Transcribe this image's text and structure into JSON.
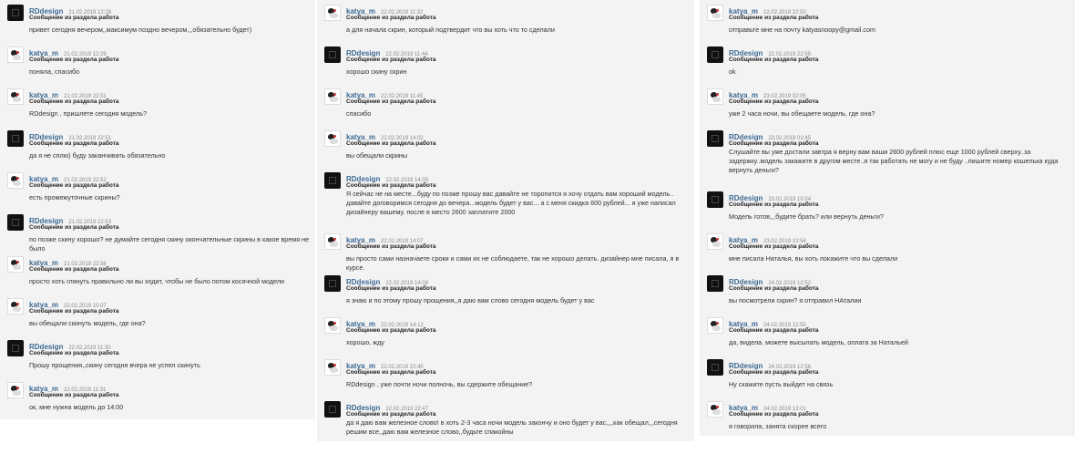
{
  "columns": [
    {
      "messages": [
        {
          "author": "RDdesign",
          "date": "21.02.2019 12:28",
          "subject": "Сообщение из раздела работа",
          "text": "привет сегодня вечером,,максимум поздно вечером,,,обязательно будет)"
        },
        {
          "author": "katya_m",
          "date": "21.02.2019 12:29",
          "subject": "Сообщение из раздела работа",
          "text": "поняла, спасибо"
        },
        {
          "author": "katya_m",
          "date": "21.02.2019 22:51",
          "subject": "Сообщение из раздела работа",
          "text": "RDdesign , пришлете сегодня модель?"
        },
        {
          "author": "RDdesign",
          "date": "21.02.2019 22:51",
          "subject": "Сообщение из раздела работа",
          "text": "да я не сплю) буду заканчивать обязательно"
        },
        {
          "author": "katya_m",
          "date": "21.02.2019 22:52",
          "subject": "Сообщение из раздела работа",
          "text": "есть промежуточные скрины?"
        },
        {
          "author": "RDdesign",
          "date": "21.02.2019 22:53",
          "subject": "Сообщение из раздела работа",
          "text": "по позже скину хорошо? не думайте сегодня скину окончательные скрины в какое время не было"
        },
        {
          "author": "katya_m",
          "date": "21.02.2019 22:56",
          "subject": "Сообщение из раздела работа",
          "text": "просто хоть глянуть правильно ли вы ходит, чтобы не было потом косячной модели"
        },
        {
          "author": "katya_m",
          "date": "22.02.2019 10:07",
          "subject": "Сообщение из раздела работа",
          "text": "вы обещали скинуть модель, где она?"
        },
        {
          "author": "RDdesign",
          "date": "22.02.2019 11:30",
          "subject": "Сообщение из раздела работа",
          "text": "Прошу прощения,,скину сегодня вчера не успел скинуть"
        },
        {
          "author": "katya_m",
          "date": "22.02.2019 11:31",
          "subject": "Сообщение из раздела работа",
          "text": "ок, мне нужна модель до 14:00"
        }
      ]
    },
    {
      "messages": [
        {
          "author": "katya_m",
          "date": "22.02.2019 11:32",
          "subject": "Сообщение из раздела работа",
          "text": "а для начала скрин, который подтвердит что вы хоть что то сделали"
        },
        {
          "author": "RDdesign",
          "date": "22.02.2019 11:44",
          "subject": "Сообщение из раздела работа",
          "text": "хорошо скину скрин"
        },
        {
          "author": "katya_m",
          "date": "22.02.2019 11:45",
          "subject": "Сообщение из раздела работа",
          "text": "спасибо"
        },
        {
          "author": "katya_m",
          "date": "22.02.2019 14:02",
          "subject": "Сообщение из раздела работа",
          "text": "вы обещали скрины"
        },
        {
          "author": "RDdesign",
          "date": "22.02.2019 14:05",
          "subject": "Сообщение из раздела работа",
          "text": "Я сейчас не на месте...буду по позже прошу вас давайте не торопится я хочу отдать вам хороший модель.. давайте договоримся сегодня до вечера...модель будет у вас... а с меня скидка 600 рублей... я уже написал дизайнеру вашему. после в место 2600 заплатите 2000",
          "tall": true
        },
        {
          "author": "katya_m",
          "date": "22.02.2019 14:07",
          "subject": "Сообщение из раздела работа",
          "text": "вы просто сами назначаете сроки и сами их не соблюдаете, так не хорошо делать. дизайнер мне писала, я в курсе."
        },
        {
          "author": "RDdesign",
          "date": "22.02.2019 14:08",
          "subject": "Сообщение из раздела работа",
          "text": "я знаю и по этому прошу прощения,,я даю вам слово сегодня модель будет у вас"
        },
        {
          "author": "katya_m",
          "date": "22.02.2019 14:12",
          "subject": "Сообщение из раздела работа",
          "text": "хорошо, жду"
        },
        {
          "author": "katya_m",
          "date": "22.02.2019 22:45",
          "subject": "Сообщение из раздела работа",
          "text": "RDdesign , уже почти ночи полночь, вы сдержите обещание?"
        },
        {
          "author": "RDdesign",
          "date": "22.02.2019 22:47",
          "subject": "Сообщение из раздела работа",
          "text": "да я даю вам железное слово! в хоть 2-3 часа ночи модель закончу и оно будет у вас,,,,как обещал,,,сегодня решим все,,даю вам железное слово,,будьте спакойны",
          "tall": true
        }
      ]
    },
    {
      "messages": [
        {
          "author": "katya_m",
          "date": "22.02.2019 22:50",
          "subject": "Сообщение из раздела работа",
          "text": "отправьте мне на почту katyasnoopy@gmail.com"
        },
        {
          "author": "RDdesign",
          "date": "22.02.2019 22:55",
          "subject": "Сообщение из раздела работа",
          "text": "ok"
        },
        {
          "author": "katya_m",
          "date": "23.02.2019 02:05",
          "subject": "Сообщение из раздела работа",
          "text": "уже 2 часа ночи, вы обещаете модель, где она?"
        },
        {
          "author": "RDdesign",
          "date": "23.02.2019 02:45",
          "subject": "Сообщение из раздела работа",
          "text": "Слушайте вы уже достали завтра я верну вам ваши 2600 рублей плюс еще 1000 рублей сверху..за задержку..модель закажите в другом месте..я так работать не могу и не буду ..пишите номер кошелька куда вернуть деньги?",
          "tall": true
        },
        {
          "author": "RDdesign",
          "date": "23.02.2019 10:54",
          "subject": "Сообщение из раздела работа",
          "text": "Модель готов,,,будите брать? или вернуть деньги?"
        },
        {
          "author": "katya_m",
          "date": "23.02.2019 13:54",
          "subject": "Сообщение из раздела работа",
          "text": "мне писала Наталья, вы хоть покажите что вы сделали"
        },
        {
          "author": "RDdesign",
          "date": "24.02.2019 12:52",
          "subject": "Сообщение из раздела работа",
          "text": "вы посмотрели скрин? я отправил НАталии"
        },
        {
          "author": "katya_m",
          "date": "24.02.2019 12:55",
          "subject": "Сообщение из раздела работа",
          "text": "да, видела. можете высылать модель, оплата за Натальей"
        },
        {
          "author": "RDdesign",
          "date": "24.02.2019 12:56",
          "subject": "Сообщение из раздела работа",
          "text": "Ну скажите пусть выйдет на связь"
        },
        {
          "author": "katya_m",
          "date": "24.02.2019 13:01",
          "subject": "Сообщение из раздела работа",
          "text": "я говорила, занята скорее всего"
        }
      ]
    }
  ]
}
